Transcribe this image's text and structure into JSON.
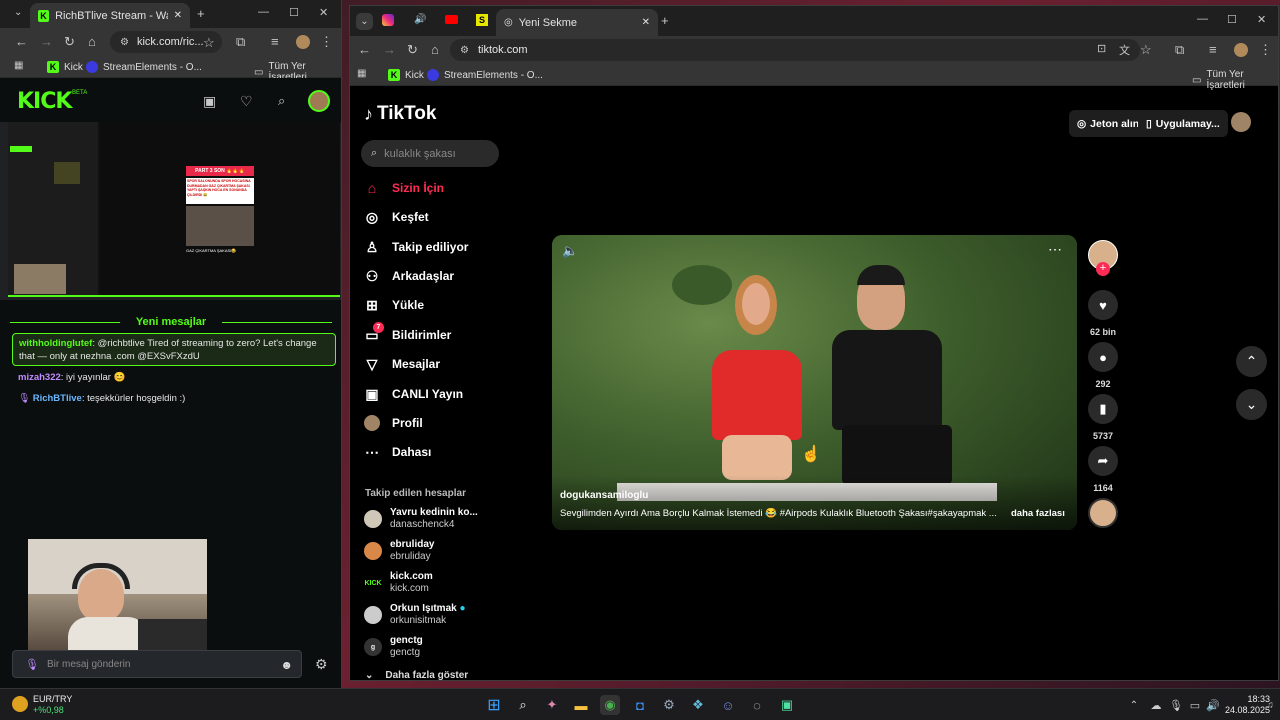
{
  "left_window": {
    "tab_title": "RichBTlive Stream - Watch Live",
    "url": "kick.com/ric...",
    "bookmarks": [
      {
        "label": "Kick"
      },
      {
        "label": "StreamElements - O..."
      }
    ],
    "bookmarks_all": "Tüm Yer İşaretleri",
    "kick": {
      "logo": "KICK",
      "beta": "BETA",
      "new_messages": "Yeni mesajlar",
      "highlighted": {
        "user": "withholdinglutef",
        "text": ": @richbtlive Tired of streaming to zero? Let's change that — only at nezhna .com @EXSvFXzdU"
      },
      "messages": [
        {
          "user": "mizah322",
          "text": ": iyi yayınlar 😊"
        },
        {
          "user": "RichBTlive",
          "text": ": teşekkürler hoşgeldin :)"
        }
      ],
      "chat_placeholder": "Bir mesaj gönderin"
    },
    "preview": {
      "part_label": "PART 3 SON 🔥🔥🔥",
      "caption": "SPOR SALONUNDA SPOR HOCASINA DURMADAN GAZ ÇIKARTMA ŞAKASI YAPTI ŞAŞKIN HOCA EN SONUNDA ÇILDIRDI 😂",
      "bottom": "GAZ ÇIKARTMA ŞAKASI😂"
    }
  },
  "right_window": {
    "tab_title": "Yeni Sekme",
    "url": "tiktok.com",
    "bookmarks": [
      {
        "label": "Kick"
      },
      {
        "label": "StreamElements - O..."
      }
    ],
    "bookmarks_all": "Tüm Yer İşaretleri"
  },
  "tiktok": {
    "logo": "TikTok",
    "search_placeholder": "kulaklık şakası",
    "get_coins": "Jeton alın",
    "get_app": "Uygulamay...",
    "nav": [
      {
        "label": "Sizin İçin",
        "icon": "home-icon",
        "active": true
      },
      {
        "label": "Keşfet",
        "icon": "compass-icon"
      },
      {
        "label": "Takip ediliyor",
        "icon": "user-follow-icon"
      },
      {
        "label": "Arkadaşlar",
        "icon": "friends-icon"
      },
      {
        "label": "Yükle",
        "icon": "upload-icon"
      },
      {
        "label": "Bildirimler",
        "icon": "notification-icon",
        "badge": "7"
      },
      {
        "label": "Mesajlar",
        "icon": "message-icon"
      },
      {
        "label": "CANLI Yayın",
        "icon": "live-icon"
      },
      {
        "label": "Profil",
        "icon": "profile-icon"
      },
      {
        "label": "Dahası",
        "icon": "more-icon"
      }
    ],
    "followed_title": "Takip edilen hesaplar",
    "followed": [
      {
        "name": "Yavru kedinin ko...",
        "user": "danaschenck4"
      },
      {
        "name": "ebruliday",
        "user": "ebruliday"
      },
      {
        "name": "kick.com",
        "user": "kick.com"
      },
      {
        "name": "Orkun Işıtmak",
        "user": "orkunisitmak"
      },
      {
        "name": "genctg",
        "user": "genctg"
      }
    ],
    "see_more": "Daha fazla göster",
    "video": {
      "author": "dogukansamiloglu",
      "caption": "Sevgilimden Ayırdı Ama Borçlu Kalmak İstemedi 😂 #Airpods Kulaklık Bluetooth Şakası#şakayapmak ...",
      "more": "daha fazlası"
    },
    "actions": {
      "likes": "62 bin",
      "comments": "292",
      "saves": "5737",
      "shares": "1164"
    }
  },
  "taskbar": {
    "currency": "EUR/TRY",
    "change": "+%0,98",
    "time": "18:33",
    "date": "24.08.2025"
  }
}
